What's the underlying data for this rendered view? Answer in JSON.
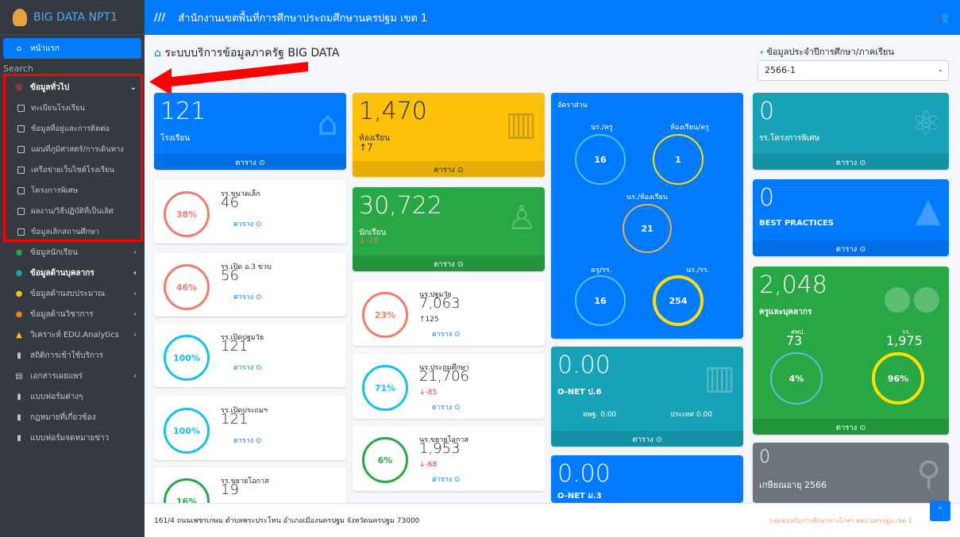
{
  "brand": "BIG DATA NPT1",
  "topbar_title": "สำนักงานเขตพื้นที่การศึกษาประถมศึกษานครปฐม เขต 1",
  "sidebar": {
    "home": "หน้าแรก",
    "search": "Search",
    "general": "ข้อมูลทั่วไป",
    "subs": [
      "ทะเบียนโรงเรียน",
      "ข้อมูลที่อยู่และการติดต่อ",
      "แผนที่ภูมิศาสตร์/การเดินทาง",
      "เครือข่ายเว็บไซต์โรงเรียน",
      "โครงการพิเศษ",
      "ผลงาน/วิธีปฏิบัติที่เป็นเลิศ",
      "ข้อมูลเลิกสถานศึกษา"
    ],
    "items": [
      "ข้อมูลนักเรียน",
      "ข้อมูลด้านบุคลากร",
      "ข้อมูลด้านงบประมาณ",
      "ข้อมูลด้านวิชาการ",
      "วิเคราะห์ EDU.Analytics",
      "สถิติการเข้าใช้บริการ",
      "เอกสารเผยแพร่",
      "แบบฟอร์มต่างๆ",
      "กฎหมายที่เกี่ยวข้อง",
      "แบบฟอร์มจดหมายข่าว"
    ]
  },
  "page_title": "ระบบบริการข้อมูลภาครัฐ BIG DATA",
  "side_title": "ข้อมูลประจำปีการศึกษา/ภาคเรียน",
  "select_value": "2566-1",
  "table_label": "ตาราง",
  "cards": {
    "schools": {
      "value": "121",
      "label": "โรงเรียน"
    },
    "rooms": {
      "value": "1,470",
      "label": "ห้องเรียน",
      "delta": "↑7"
    },
    "students": {
      "value": "30,722",
      "label": "นักเรียน",
      "delta": "↓-28"
    },
    "special": {
      "value": "0",
      "label": "รร.โครงการพิเศษ"
    },
    "best": {
      "value": "0",
      "label": "BEST PRACTICES"
    },
    "teachers": {
      "value": "2,048",
      "label": "ครูและบุคลากร",
      "a_label": "สพป.",
      "a_val": "73",
      "b_label": "รร.",
      "b_val": "1,975",
      "a_pct": "4%",
      "b_pct": "96%"
    },
    "retire": {
      "value": "0",
      "label": "เกษียณอายุ 2566"
    },
    "onet6": {
      "value": "0.00",
      "label": "O-NET ป.6",
      "a": "สพฐ. 0.00",
      "b": "ประเทศ 0.00"
    },
    "onet3": {
      "value": "0.00",
      "label": "O-NET ม.3"
    }
  },
  "ratio": {
    "title": "อัตราส่วน",
    "a": "นร./ครู",
    "a_v": "16",
    "b": "ห้องเรียน/ครู",
    "b_v": "1",
    "c": "นร./ห้องเรียน",
    "c_v": "21",
    "d": "ครู/รร.",
    "d_v": "16",
    "e": "นร./รร.",
    "e_v": "254"
  },
  "small": [
    {
      "pct": "38%",
      "t1": "รร.ขนาดเล็ก",
      "t2": "46",
      "color": "#f27c6b"
    },
    {
      "pct": "46%",
      "t1": "รร.เปิด อ.3 ขวบ",
      "t2": "56",
      "color": "#f27c6b"
    },
    {
      "pct": "100%",
      "t1": "รร.เปิดปฐมวัย",
      "t2": "121",
      "color": "#17c0e8"
    },
    {
      "pct": "100%",
      "t1": "รร.เปิดประถมฯ",
      "t2": "121",
      "color": "#17c0e8"
    },
    {
      "pct": "16%",
      "t1": "รร.ขยายโอกาส",
      "t2": "19",
      "color": "#28a745"
    }
  ],
  "levels": [
    {
      "pct": "23%",
      "t1": "นร.ปฐมวัย",
      "t2": "7,063",
      "d": "↑125",
      "color": "#f27c6b"
    },
    {
      "pct": "71%",
      "t1": "นร.ประถมศึกษา",
      "t2": "21,706",
      "d": "↓-85",
      "color": "#17c0e8"
    },
    {
      "pct": "6%",
      "t1": "นร.ขยายโอกาส",
      "t2": "1,953",
      "d": "↓-68",
      "color": "#28a745"
    }
  ],
  "footer": "161/4 ถนนเพชรเกษม ตำบลพระประโทน อำเภอเมืองนครปฐม จังหวัดนครปฐม 73000",
  "footer_right": "กลุ่มส่งเสริมการศึกษาทางไกลฯ สพป.นครปฐม เขต 1"
}
